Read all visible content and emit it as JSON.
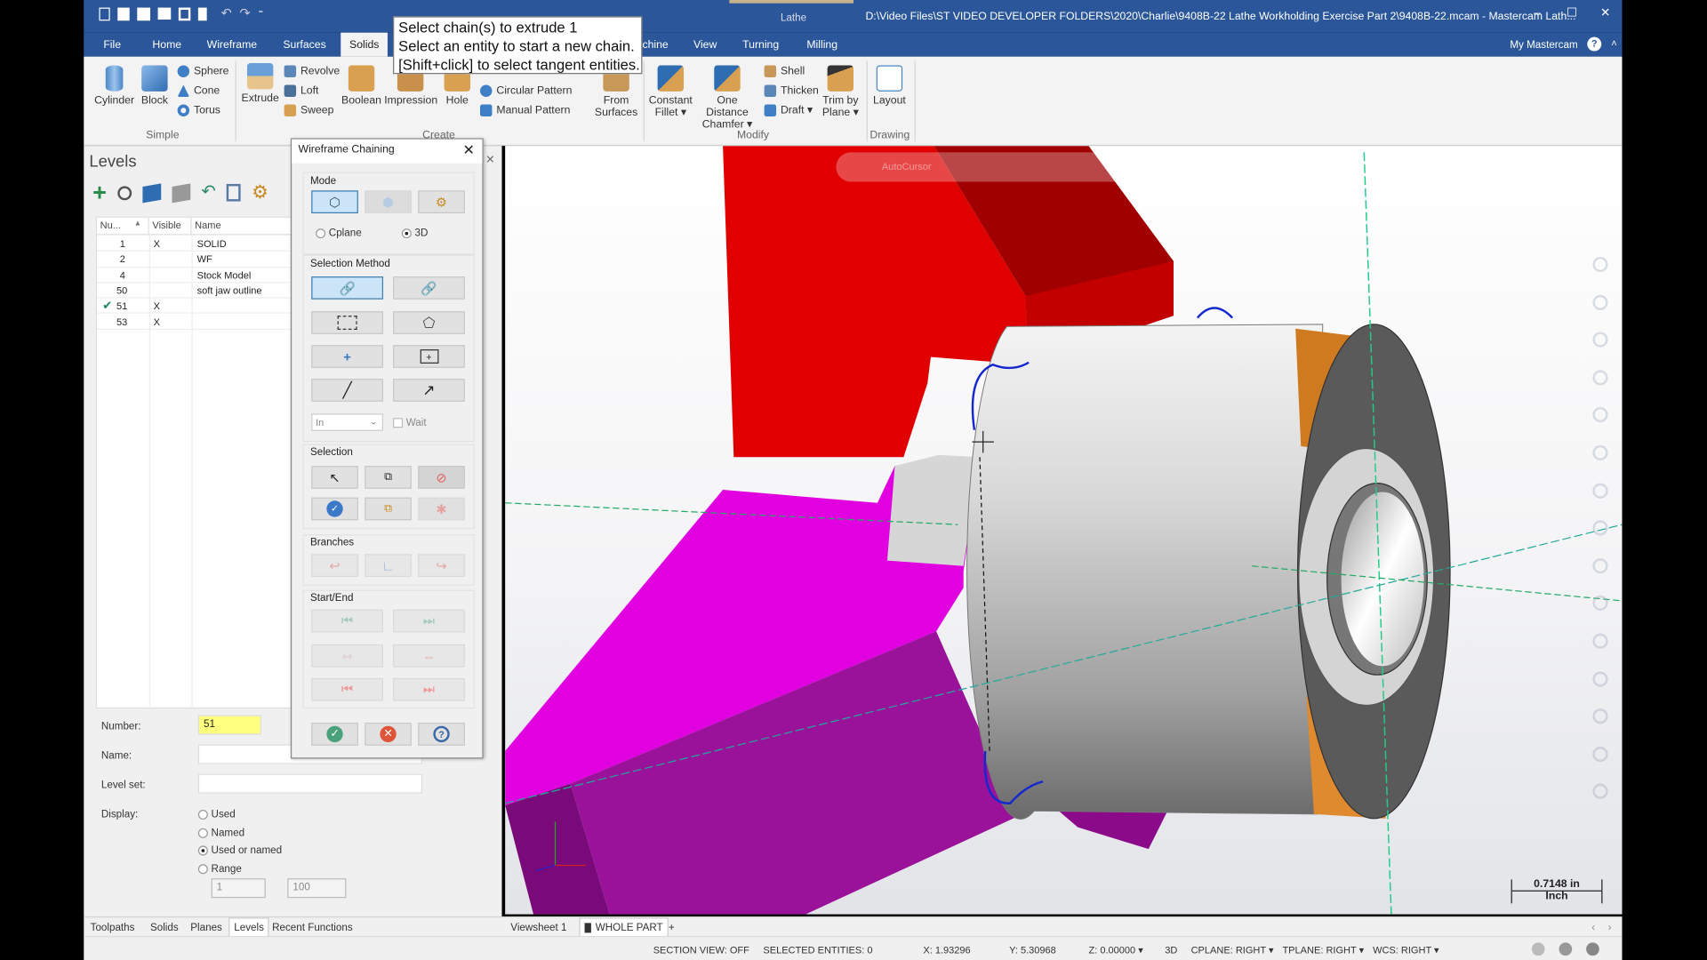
{
  "window": {
    "title": "D:\\Video Files\\ST VIDEO DEVELOPER FOLDERS\\2020\\Charlie\\9408B-22 Lathe Workholding Exercise Part 2\\9408B-22.mcam - Mastercam Lath...",
    "context_tab": "Lathe",
    "my_mastercam": "My Mastercam",
    "controls": {
      "minimize": "–",
      "maximize": "☐",
      "close": "✕"
    }
  },
  "ribbon_tabs": [
    {
      "label": "File"
    },
    {
      "label": "Home"
    },
    {
      "label": "Wireframe"
    },
    {
      "label": "Surfaces"
    },
    {
      "label": "Solids",
      "active": true
    },
    {
      "label": "chine"
    },
    {
      "label": "View"
    },
    {
      "label": "Turning"
    },
    {
      "label": "Milling"
    }
  ],
  "ribbon": {
    "simple": {
      "group": "Simple",
      "cylinder": "Cylinder",
      "block": "Block",
      "sphere": "Sphere",
      "cone": "Cone",
      "torus": "Torus"
    },
    "create": {
      "group": "Create",
      "extrude": "Extrude",
      "revolve": "Revolve",
      "loft": "Loft",
      "sweep": "Sweep",
      "boolean": "Boolean",
      "impression": "Impression",
      "hole": "Hole",
      "circular_pattern": "Circular Pattern",
      "manual_pattern": "Manual Pattern",
      "from_surfaces": "From Surfaces"
    },
    "modify": {
      "group": "Modify",
      "constant_fillet": "Constant Fillet ▾",
      "one_distance_chamfer": "One Distance Chamfer ▾",
      "shell": "Shell",
      "thicken": "Thicken",
      "draft": "Draft ▾",
      "trim_by_plane": "Trim by Plane ▾"
    },
    "drawing": {
      "group": "Drawing",
      "layout": "Layout"
    }
  },
  "tooltip": {
    "line1": "Select chain(s) to extrude 1",
    "line2": "Select an entity to start a new chain.",
    "line3": "[Shift+click] to select tangent entities."
  },
  "levels": {
    "title": "Levels",
    "columns": [
      "Nu...",
      "Visible",
      "Name"
    ],
    "rows": [
      {
        "number": "1",
        "visible": "X",
        "name": "SOLID"
      },
      {
        "number": "2",
        "visible": "",
        "name": "WF"
      },
      {
        "number": "4",
        "visible": "",
        "name": "Stock Model"
      },
      {
        "number": "50",
        "visible": "",
        "name": "soft jaw outline"
      },
      {
        "number": "51",
        "visible": "X",
        "name": "",
        "active": true
      },
      {
        "number": "53",
        "visible": "X",
        "name": ""
      }
    ],
    "number_label": "Number:",
    "number_value": "51",
    "name_label": "Name:",
    "name_value": "",
    "level_set_label": "Level set:",
    "level_set_value": "",
    "display_label": "Display:",
    "display_options": [
      "Used",
      "Named",
      "Used or named",
      "Range"
    ],
    "display_selected": "Used or named",
    "range_from": "1",
    "range_to": "100"
  },
  "panel_tabs": [
    {
      "label": "Toolpaths"
    },
    {
      "label": "Solids"
    },
    {
      "label": "Planes"
    },
    {
      "label": "Levels",
      "active": true
    },
    {
      "label": "Recent Functions"
    }
  ],
  "chaining_dialog": {
    "title": "Wireframe Chaining",
    "mode_label": "Mode",
    "cplane_label": "Cplane",
    "threed_label": "3D",
    "mode_selected": "3D",
    "selection_method_label": "Selection Method",
    "inside_option": "In",
    "wait_label": "Wait",
    "selection_label": "Selection",
    "branches_label": "Branches",
    "start_end_label": "Start/End"
  },
  "viewport": {
    "autocursor": "AutoCursor",
    "scale_value": "0.7148 in",
    "scale_unit": "Inch",
    "colors": {
      "jaw_red": "#e00000",
      "jaw_magenta": "#e000e0",
      "chain_blue": "#1428d0",
      "band_orange": "#d07a20"
    }
  },
  "viewsheets": {
    "sheet": "Viewsheet 1",
    "bookmark": "WHOLE PART",
    "add": "+"
  },
  "status": {
    "section_view": "SECTION VIEW: OFF",
    "selected": "SELECTED ENTITIES: 0",
    "x": "X:  1.93296",
    "y": "Y:  5.30968",
    "z": "Z:  0.00000 ▾",
    "mode": "3D",
    "cplane": "CPLANE: RIGHT ▾",
    "tplane": "TPLANE: RIGHT ▾",
    "wcs": "WCS: RIGHT ▾"
  }
}
